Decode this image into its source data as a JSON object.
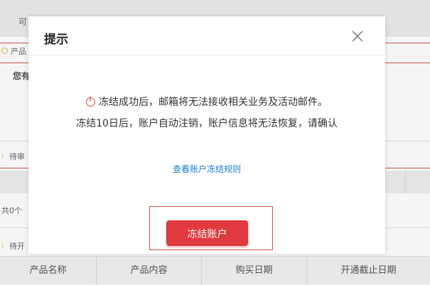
{
  "background": {
    "top_text": "可",
    "section_product": "产品",
    "greeting": "您有",
    "section_pending_review": "待审",
    "count_text": "共0个",
    "section_pending_open": "待开",
    "table_headers": [
      "产品名称",
      "产品内容",
      "购买日期",
      "开通截止日期"
    ]
  },
  "dialog": {
    "title": "提示",
    "message_line1": "冻结成功后，邮箱将无法接收相关业务及活动邮件。",
    "message_line2": "冻结10日后，账户自动注销，账户信息将无法恢复，请确认",
    "rules_link": "查看账户冻结规则",
    "confirm_button": "冻结账户"
  },
  "colors": {
    "accent_red": "#e0393e",
    "link_blue": "#1a7fd4",
    "highlight_frame": "#d9534f"
  }
}
